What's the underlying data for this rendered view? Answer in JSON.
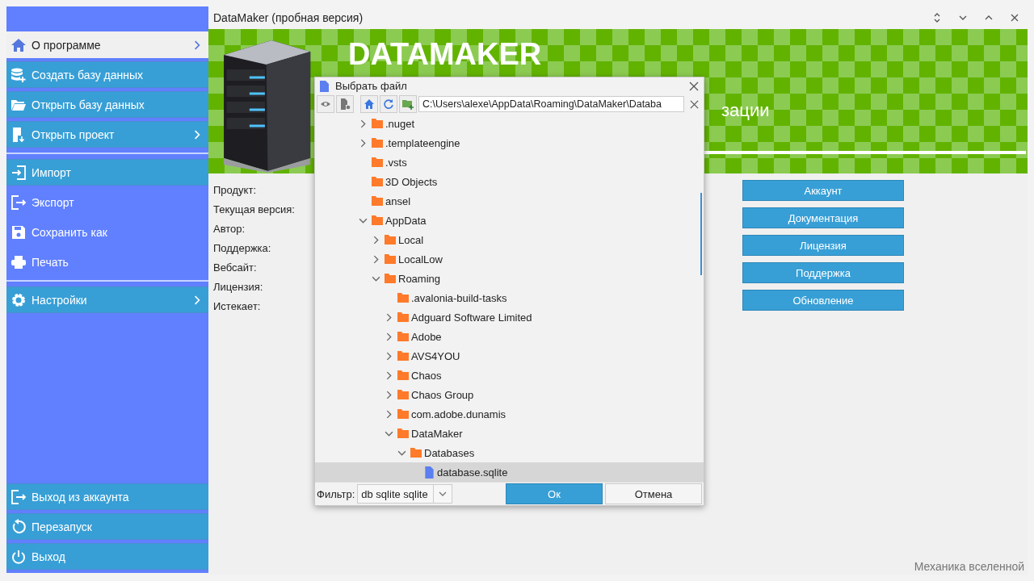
{
  "sidebar": {
    "items": [
      {
        "label": "О программе",
        "kind": "tile",
        "selected": true,
        "has_submenu": true
      },
      {
        "label": "Создать базу данных",
        "kind": "tile",
        "selected": false,
        "has_submenu": false
      },
      {
        "label": "Открыть базу данных",
        "kind": "tile",
        "selected": false,
        "has_submenu": false
      },
      {
        "label": "Открыть проект",
        "kind": "tile",
        "selected": false,
        "has_submenu": true
      },
      {
        "label": "Импорт",
        "kind": "tile",
        "selected": false,
        "has_submenu": false
      },
      {
        "label": "Экспорт",
        "kind": "plain",
        "selected": false,
        "has_submenu": false
      },
      {
        "label": "Сохранить как",
        "kind": "plain",
        "selected": false,
        "has_submenu": false
      },
      {
        "label": "Печать",
        "kind": "plain",
        "selected": false,
        "has_submenu": false
      },
      {
        "label": "Настройки",
        "kind": "tile",
        "selected": false,
        "has_submenu": true
      }
    ],
    "bottom_items": [
      {
        "label": "Выход из аккаунта"
      },
      {
        "label": "Перезапуск"
      },
      {
        "label": "Выход"
      }
    ]
  },
  "window": {
    "title": "DataMaker (пробная версия)"
  },
  "header": {
    "title": "DATAMAKER",
    "subtitle": "зации"
  },
  "info_labels": [
    "Продукт:",
    "Текущая версия:",
    "Автор:",
    "Поддержка:",
    "Вебсайт:",
    "Лицензия:",
    "Истекает:"
  ],
  "action_buttons": [
    "Аккаунт",
    "Документация",
    "Лицензия",
    "Поддержка",
    "Обновление"
  ],
  "footer_text": "Механика вселенной",
  "dialog": {
    "title": "Выбрать файл",
    "path": "C:\\Users\\alexe\\AppData\\Roaming\\DataMaker\\Databa",
    "tree": [
      {
        "name": ".nuget",
        "kind": "folder",
        "has_children": true,
        "expanded": false,
        "selected": false
      },
      {
        "name": ".templateengine",
        "kind": "folder",
        "has_children": true,
        "expanded": false,
        "selected": false
      },
      {
        "name": ".vsts",
        "kind": "folder",
        "has_children": false,
        "selected": false
      },
      {
        "name": "3D Objects",
        "kind": "folder",
        "has_children": false,
        "selected": false
      },
      {
        "name": "ansel",
        "kind": "folder",
        "has_children": false,
        "selected": false
      },
      {
        "name": "AppData",
        "kind": "folder",
        "has_children": true,
        "expanded": true,
        "selected": false,
        "children": [
          {
            "name": "Local",
            "kind": "folder",
            "has_children": true,
            "expanded": false,
            "selected": false
          },
          {
            "name": "LocalLow",
            "kind": "folder",
            "has_children": true,
            "expanded": false,
            "selected": false
          },
          {
            "name": "Roaming",
            "kind": "folder",
            "has_children": true,
            "expanded": true,
            "selected": false,
            "children": [
              {
                "name": ".avalonia-build-tasks",
                "kind": "folder",
                "has_children": false,
                "selected": false
              },
              {
                "name": "Adguard Software Limited",
                "kind": "folder",
                "has_children": true,
                "expanded": false,
                "selected": false
              },
              {
                "name": "Adobe",
                "kind": "folder",
                "has_children": true,
                "expanded": false,
                "selected": false
              },
              {
                "name": "AVS4YOU",
                "kind": "folder",
                "has_children": true,
                "expanded": false,
                "selected": false
              },
              {
                "name": "Chaos",
                "kind": "folder",
                "has_children": true,
                "expanded": false,
                "selected": false
              },
              {
                "name": "Chaos Group",
                "kind": "folder",
                "has_children": true,
                "expanded": false,
                "selected": false
              },
              {
                "name": "com.adobe.dunamis",
                "kind": "folder",
                "has_children": true,
                "expanded": false,
                "selected": false
              },
              {
                "name": "DataMaker",
                "kind": "folder",
                "has_children": true,
                "expanded": true,
                "selected": false,
                "children": [
                  {
                    "name": "Databases",
                    "kind": "folder",
                    "has_children": true,
                    "expanded": true,
                    "selected": false,
                    "children": [
                      {
                        "name": "database.sqlite",
                        "kind": "file",
                        "has_children": false,
                        "selected": true
                      }
                    ]
                  }
                ]
              }
            ]
          }
        ]
      }
    ],
    "filter_label": "Фильтр:",
    "filter_value": "db sqlite sqlite",
    "ok": "Ок",
    "cancel": "Отмена"
  }
}
